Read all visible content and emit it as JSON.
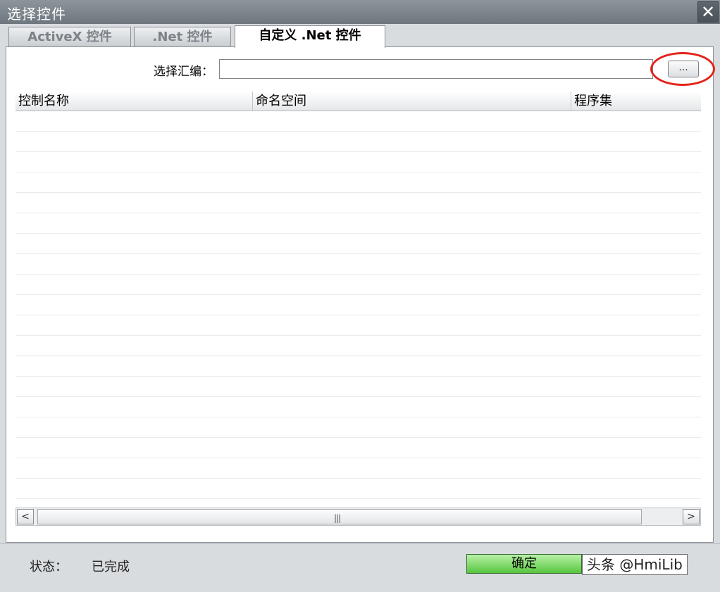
{
  "window": {
    "title": "选择控件",
    "close_label": "✕"
  },
  "tabs": [
    {
      "label": "ActiveX 控件",
      "active": false
    },
    {
      "label": ".Net 控件",
      "active": false
    },
    {
      "label": "自定义 .Net 控件",
      "active": true
    }
  ],
  "assembly": {
    "label": "选择汇编：",
    "value": "",
    "browse_label": "..."
  },
  "grid": {
    "columns": [
      "控制名称",
      "命名空间",
      "程序集"
    ],
    "rows": []
  },
  "scrollbar": {
    "left_arrow": "<",
    "right_arrow": ">",
    "grip": "|||"
  },
  "status": {
    "label": "状态：",
    "value": "已完成"
  },
  "ok_label": "确定",
  "watermark": "头条 @HmiLib",
  "colors": {
    "ok_button": "#57c63f",
    "highlight_ring": "#e2231a",
    "titlebar": "#7a828a"
  }
}
